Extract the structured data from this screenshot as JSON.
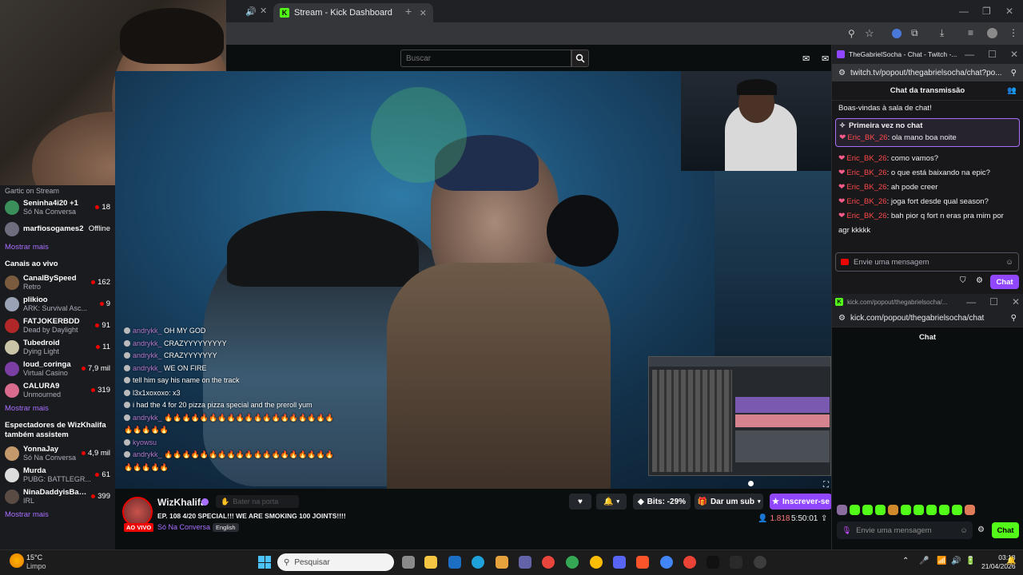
{
  "browser": {
    "tab_title": "Stream - Kick Dashboard"
  },
  "kick": {
    "search_placeholder": "Buscar",
    "sidebar": {
      "top_partial": {
        "name": "Gartic on Stream"
      },
      "followed": [
        {
          "name": "Seninha4i20 +1",
          "category": "Só Na Conversa",
          "viewers": "18",
          "color": "#3a8f5a"
        },
        {
          "name": "marfiosogames2",
          "category": "",
          "viewers": "Offline",
          "color": "#6d6d7d"
        }
      ],
      "show_more_1": "Mostrar mais",
      "live_heading": "Canais ao vivo",
      "live": [
        {
          "name": "CanalBySpeed",
          "category": "Retro",
          "viewers": "162",
          "color": "#7a5b3e"
        },
        {
          "name": "plikioo",
          "category": "ARK: Survival Asc...",
          "viewers": "9",
          "color": "#9aa3b5"
        },
        {
          "name": "FATJOKERBDD",
          "category": "Dead by Daylight",
          "viewers": "91",
          "color": "#b02828"
        },
        {
          "name": "Tubedroid",
          "category": "Dying Light",
          "viewers": "11",
          "color": "#c9c3a8"
        },
        {
          "name": "loud_coringa",
          "category": "Virtual Casino",
          "viewers": "7,9 mil",
          "color": "#7b3fa3"
        },
        {
          "name": "CALURA9",
          "category": "Unmourned",
          "viewers": "319",
          "color": "#d96b8e"
        }
      ],
      "show_more_2": "Mostrar mais",
      "also_heading": "Espectadores de WizKhalifa também assistem",
      "also": [
        {
          "name": "YonnaJay",
          "category": "Só Na Conversa",
          "viewers": "4,9 mil",
          "color": "#c49a6c"
        },
        {
          "name": "Murda",
          "category": "PUBG: BATTLEGR...",
          "viewers": "61",
          "color": "#dddddd"
        },
        {
          "name": "NinaDaddyisBack",
          "category": "IRL",
          "viewers": "399",
          "color": "#5a4c44"
        }
      ],
      "show_more_3": "Mostrar mais"
    },
    "overlay_chat": [
      {
        "user": "andrykk_",
        "text": "OH MY GOD"
      },
      {
        "user": "andrykk_",
        "text": "CRAZYYYYYYYYY"
      },
      {
        "user": "andrykk_",
        "text": "CRAZYYYYYYY"
      },
      {
        "user": "andrykk_",
        "text": "WE ON FIRE"
      },
      {
        "user": "",
        "text": "tell him say his name on the track"
      },
      {
        "user": "",
        "text": "l3x1xoxoxo: x3"
      },
      {
        "user": "",
        "text": "i had the 4 for 20 pizza pizza special and the preroll yum"
      },
      {
        "user": "andrykk_",
        "text": "🔥🔥🔥🔥🔥🔥🔥🔥🔥🔥🔥🔥🔥🔥🔥🔥🔥🔥🔥🔥🔥🔥🔥🔥"
      },
      {
        "user": "kyowsu",
        "text": ""
      },
      {
        "user": "andrykk_",
        "text": "🔥🔥🔥🔥🔥🔥🔥🔥🔥🔥🔥🔥🔥🔥🔥🔥🔥🔥🔥🔥🔥🔥🔥🔥"
      }
    ],
    "streamer": {
      "name": "WizKhalifa",
      "knock_label": "Bater na porta",
      "title": "EP. 108 4/20 SPECIAL!!! WE ARE SMOKING 100 JOINTS!!!!",
      "live_badge": "AO VIVO",
      "category": "Só Na Conversa",
      "language": "English",
      "bits_label": "Bits: -29%",
      "gift_label": "Dar um sub",
      "subscribe_label": "Inscrever-se",
      "viewers": "1.818",
      "uptime": "5:50:01"
    }
  },
  "twitch": {
    "window_title": "TheGabrielSocha - Chat - Twitch -...",
    "url": "twitch.tv/popout/thegabrielsocha/chat?po...",
    "chat_header": "Chat da transmissão",
    "welcome": "Boas-vindas à sala de chat!",
    "first_time_label": "Primeira vez no chat",
    "messages": [
      {
        "user": "Eric_BK_26",
        "text": "ola mano boa noite",
        "first": true
      },
      {
        "user": "Eric_BK_26",
        "text": "como vamos?"
      },
      {
        "user": "Eric_BK_26",
        "text": "o que está baixando na epic?"
      },
      {
        "user": "Eric_BK_26",
        "text": "ah pode creer"
      },
      {
        "user": "Eric_BK_26",
        "text": "joga fort desde qual season?"
      },
      {
        "user": "Eric_BK_26",
        "text": "bah pior q fort n eras pra mim por agr kkkkk"
      }
    ],
    "input_placeholder": "Envie uma mensagem",
    "chat_button": "Chat"
  },
  "kick_popout": {
    "window_title": "kick.com/popout/thegabrielsocha/...",
    "url": "kick.com/popout/thegabrielsocha/chat",
    "chat_header": "Chat",
    "input_placeholder": "Envie uma mensagem",
    "chat_button": "Chat"
  },
  "taskbar": {
    "weather_temp": "15°C",
    "weather_desc": "Limpo",
    "search_placeholder": "Pesquisar",
    "time": "03:18",
    "date": "21/04/2026"
  }
}
